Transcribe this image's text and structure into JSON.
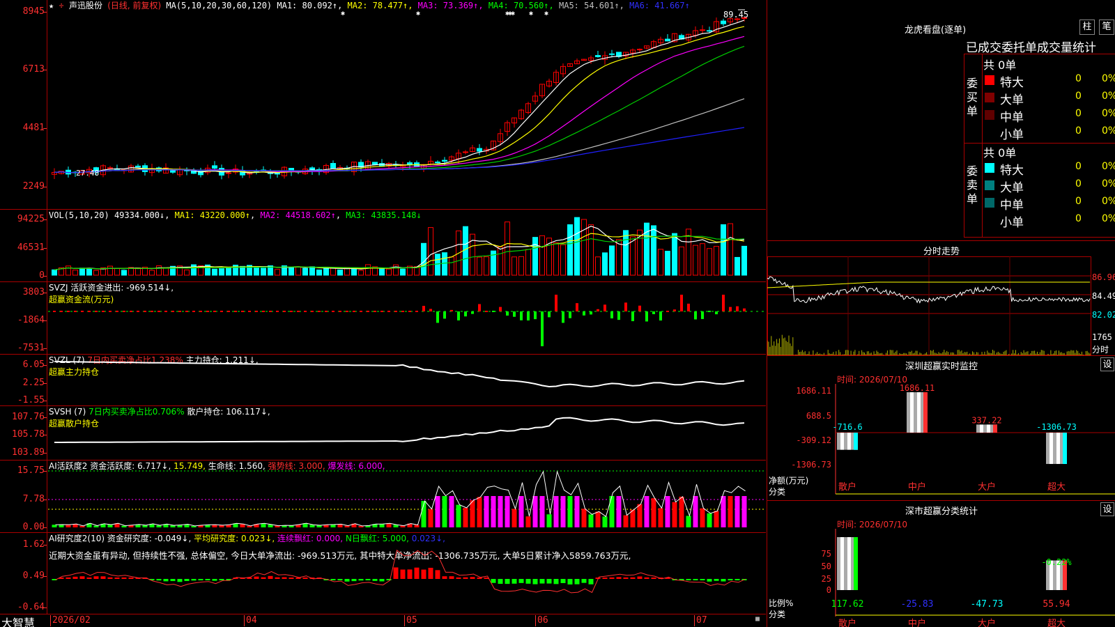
{
  "app": {
    "brand": "大智慧"
  },
  "main": {
    "title": "声迅股份",
    "mode": "(日线, 前复权)",
    "ma_params": "MA(5,10,20,30,60,120)",
    "ma_values": [
      {
        "label": "MA1:",
        "value": "80.092↑",
        "color": "#ffffff"
      },
      {
        "label": "MA2:",
        "value": "78.477↑",
        "color": "#ffff00"
      },
      {
        "label": "MA3:",
        "value": "73.369↑",
        "color": "#ff00ff"
      },
      {
        "label": "MA4:",
        "value": "70.560↑",
        "color": "#00ff00"
      },
      {
        "label": "MA5:",
        "value": "54.601↑",
        "color": "#c0c0c0"
      },
      {
        "label": "MA6:",
        "value": "41.667↑",
        "color": "#3030ff"
      }
    ],
    "y_labels": [
      "8945",
      "6713",
      "4481",
      "2249"
    ],
    "high_label": "89.45",
    "low_label": "27.48"
  },
  "vol": {
    "header": "VOL(5,10,20)",
    "value": "49334.000↓",
    "ma1": "MA1: 43220.000↑",
    "ma2": "MA2: 44518.602↑",
    "ma3": "MA3: 43835.148↓",
    "y_labels": [
      "94225",
      "46531",
      "0"
    ]
  },
  "svzj": {
    "header": "SVZJ  活跃资金进出: -969.514↓,",
    "sub": "超赢资金流(万元)",
    "y_labels": [
      "3803",
      "-1864",
      "-7531"
    ]
  },
  "svzl": {
    "name": "SVZL (7)",
    "ratio": "7日内买卖净占比1.238%",
    "holding": "主力持仓: 1.211↓,",
    "sub": "超赢主力持仓",
    "y_labels": [
      "6.05",
      "2.25",
      "-1.55"
    ]
  },
  "svsh": {
    "name": "SVSH (7)",
    "ratio": "7日内买卖净占比0.706%",
    "holding": "散户持仓: 106.117↓,",
    "sub": "超赢散户持仓",
    "y_labels": [
      "107.76",
      "105.78",
      "103.89"
    ]
  },
  "ai1": {
    "name": "AI活跃度2",
    "a": "资金活跃度: 6.717↓,",
    "b": "15.749,",
    "c": "生命线: 1.560,",
    "d": "强势线: 3.000,",
    "e": "爆发线: 6.000,",
    "y_labels": [
      "15.75",
      "7.78",
      "0.00"
    ]
  },
  "ai2": {
    "name": "AI研究度2(10)",
    "a": "资金研究度: -0.049↓,",
    "b": "平均研究度: 0.023↓,",
    "c": "连续飘红: 0.000,",
    "d": "N日飘红: 5.000,",
    "e": "0.023↓,",
    "comment": "近期大资金虽有异动, 但持续性不强, 总体偏空, 今日大单净流出: -969.513万元, 其中特大单净流出: -1306.735万元, 大单5日累计净入5859.763万元,",
    "y_labels": [
      "1.62",
      "0.49",
      "-0.64"
    ]
  },
  "xaxis": [
    "2026/02",
    "04",
    "05",
    "06",
    "07"
  ],
  "lhb": {
    "title": "龙虎看盘(逐单)",
    "btn1": "柱",
    "btn2": "笔",
    "subtitle": "已成交委托单成交量统计",
    "buy_label": "委买单",
    "sell_label": "委卖单",
    "buy_total": "共 0单",
    "sell_total": "共 0单",
    "buy_rows": [
      {
        "name": "特大",
        "count": "0",
        "pct": "0%",
        "color": "#ff0000"
      },
      {
        "name": "大单",
        "count": "0",
        "pct": "0%",
        "color": "#800000"
      },
      {
        "name": "中单",
        "count": "0",
        "pct": "0%",
        "color": "#600000"
      },
      {
        "name": "小单",
        "count": "0",
        "pct": "0%",
        "color": ""
      }
    ],
    "sell_rows": [
      {
        "name": "特大",
        "count": "0",
        "pct": "0%",
        "color": "#00ffff"
      },
      {
        "name": "大单",
        "count": "0",
        "pct": "0%",
        "color": "#008080"
      },
      {
        "name": "中单",
        "count": "0",
        "pct": "0%",
        "color": "#006868"
      },
      {
        "name": "小单",
        "count": "0",
        "pct": "0%",
        "color": ""
      }
    ]
  },
  "intraday": {
    "title": "分时走势",
    "y_labels": [
      "86.96",
      "84.49",
      "82.02"
    ],
    "vol_label": "1765",
    "vol_unit": "分时"
  },
  "monitor": {
    "title": "深圳超赢实时监控",
    "btn": "设",
    "time": "时间: 2026/07/10",
    "y_labels": [
      "1686.11",
      "688.5",
      "-309.12",
      "-1306.73"
    ],
    "unit": "净额(万元)",
    "cat_label": "分类",
    "categories": [
      "散户",
      "中户",
      "大户",
      "超大"
    ],
    "bar_labels": [
      "-716.6",
      "1686.11",
      "337.22",
      "-1306.73"
    ]
  },
  "classify": {
    "title": "深市超赢分类统计",
    "btn": "设",
    "time": "时间: 2026/07/10",
    "y_labels": [
      "75",
      "50",
      "25",
      "0"
    ],
    "unit": "比例%",
    "cat_label": "分类",
    "categories": [
      "散户",
      "中户",
      "大户",
      "超大"
    ],
    "values": [
      "117.62",
      "-25.83",
      "-47.73",
      "55.94"
    ],
    "top_label": "-0.22%"
  },
  "colors": {
    "up": "#ff0000",
    "down": "#00ffff",
    "grid": "#a00000",
    "axis": "#ff3030"
  }
}
